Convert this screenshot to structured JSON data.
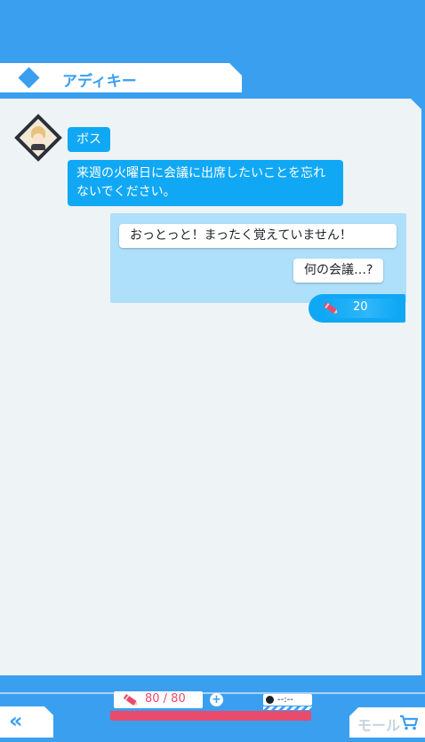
{
  "header": {
    "title": "アディキー"
  },
  "conversation": {
    "speaker_name": "ボス",
    "npc_message": "来週の火曜日に会議に出席したいことを忘れないでください。",
    "reply_options": [
      "おっとっと！まったく覚えていません！",
      "何の会議…?"
    ],
    "ticket_cost": "20"
  },
  "footer": {
    "stamina_text": "80 / 80",
    "stamina_fraction": 1.0,
    "plus_label": "+",
    "timer_text": "--:--",
    "back_label": "«",
    "mall_label": "モール"
  },
  "colors": {
    "background": "#3b9ff0",
    "bubble": "#10a8f5",
    "reply_area": "#aee0fb",
    "stamina": "#e84b6b"
  },
  "icons": [
    "diamond-icon",
    "avatar-icon",
    "pencil-icon",
    "plus-icon",
    "clock-icon",
    "back-chevron-icon",
    "cart-icon"
  ]
}
